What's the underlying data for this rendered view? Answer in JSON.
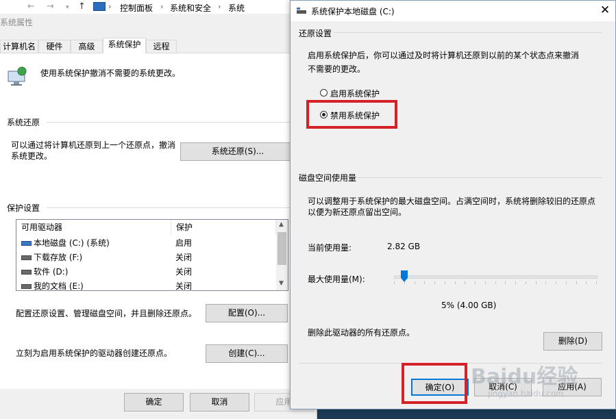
{
  "explorer": {
    "path": [
      "控制面板",
      "系统和安全",
      "系统"
    ]
  },
  "props": {
    "title": "系统属性",
    "tabs": [
      "计算机名",
      "硬件",
      "高级",
      "系统保护",
      "远程"
    ],
    "intro": "使用系统保护撤消不需要的系统更改。",
    "restore_section": "系统还原",
    "restore_desc": "可以通过将计算机还原到上一个还原点，撤消系统更改。",
    "restore_button": "系统还原(S)...",
    "protection_section": "保护设置",
    "drive_list": {
      "headers": [
        "可用驱动器",
        "保护"
      ],
      "rows": [
        {
          "name": "本地磁盘 (C:) (系统)",
          "status": "启用"
        },
        {
          "name": "下载存放 (F:)",
          "status": "关闭"
        },
        {
          "name": "软件 (D:)",
          "status": "关闭"
        },
        {
          "name": "我的文档 (E:)",
          "status": "关闭"
        }
      ]
    },
    "configure_desc": "配置还原设置、管理磁盘空间，并且删除还原点。",
    "configure_button": "配置(O)...",
    "create_desc": "立刻为启用系统保护的驱动器创建还原点。",
    "create_button": "创建(C)...",
    "ok_button": "确定",
    "cancel_button": "取消",
    "apply_button": "应用"
  },
  "dialog": {
    "title": "系统保护本地磁盘 (C:)",
    "restore_settings_label": "还原设置",
    "restore_settings_desc": "启用系统保护后，你可以通过及时将计算机还原到以前的某个状态点来撤消不需要的更改。",
    "radio_enable": "启用系统保护",
    "radio_disable": "禁用系统保护",
    "selected_option": "disable",
    "disk_usage_label": "磁盘空间使用量",
    "disk_usage_desc": "可以调整用于系统保护的最大磁盘空间。占满空间时，系统将删除较旧的还原点以便为新还原点留出空间。",
    "current_usage_label": "当前使用量:",
    "current_usage_value": "2.82 GB",
    "max_usage_label": "最大使用量(M):",
    "max_usage_percent": 5,
    "max_usage_text": "5% (4.00 GB)",
    "delete_desc": "删除此驱动器的所有还原点。",
    "delete_button": "删除(D)",
    "ok_button": "确定(O)",
    "cancel_button": "取消(C)",
    "apply_button": "应用(A)"
  },
  "watermark": {
    "text": "Baidu经验",
    "sub": "jingyan.baidu.com"
  },
  "colors": {
    "highlight": "#d42027",
    "slider": "#0078d7"
  }
}
